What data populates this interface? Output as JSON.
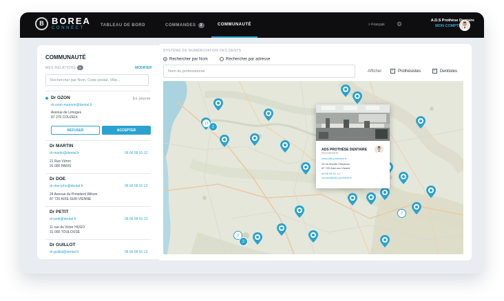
{
  "app": {
    "logo_mark": "B",
    "logo_name": "BOREA",
    "logo_sub": "CONNECT"
  },
  "nav": {
    "tab_dashboard": "TABLEAU DE BORD",
    "tab_orders": "COMMANDES",
    "orders_count": "3",
    "tab_community": "COMMUNAUTÉ",
    "language": "> Français",
    "account_name": "A.D.S Prothèse Dentaire",
    "account_link": "MON COMPTE"
  },
  "left": {
    "title": "COMMUNAUTÉ",
    "relations_label": "MES RELATIONS",
    "relations_count": "5",
    "edit_link": "MODIFIER",
    "search_placeholder": "Rechercher par Nom, Code postal, Ville...",
    "pending": {
      "name": "Dr OZON",
      "email": "dr-ozon-marjorie@dental.fr",
      "status": "En attente",
      "address1": "Avenue de Limoges",
      "address2": "87 270 COUZEIX",
      "decline": "REFUSER",
      "accept": "ACCEPTER"
    },
    "contacts": [
      {
        "name": "Dr MARTIN",
        "email": "dr-martin@dental.fr",
        "phone": "06 66 58 91 12",
        "address1": "21 Rue Véron",
        "address2": "91 000 PARIS"
      },
      {
        "name": "Dr DOE",
        "email": "dr-doe-john@dental.fr",
        "phone": "06 66 58 91 12",
        "address1": "24 Avenue du Président Wilson",
        "address2": "87 720 AIXE-SUR-VIENNE"
      },
      {
        "name": "Dr PETIT",
        "email": "dr-petit@dental.fr",
        "phone": "06 66 58 91 12",
        "address1": "11 rue du Victor HUGO",
        "address2": "31 000 TOULOUSE"
      },
      {
        "name": "Dr GUILLOT",
        "email": "dr-guillot@dental.fr",
        "phone": "06 66 58 91 12",
        "address1": "",
        "address2": ""
      }
    ]
  },
  "right": {
    "section_label": "SYSTÈME DE NUMÉROTATION DES DENTS",
    "radio_name": "Rechercher par Nom",
    "radio_address": "Rechercher par adresse",
    "name_placeholder": "Nom du professionnel",
    "show_label": "Afficher",
    "filter_prosthetists": "Prothésistes",
    "filter_dentists": "Dentistes"
  },
  "popup": {
    "name": "ADS PROTHÈSE DENTAIRE",
    "role": "PROTHÉSISTE",
    "website": "www.ads-prothese.fr",
    "address1": "24 du Moulin Cheyroux",
    "address2": "87 720 Aixe-sur-Vienne",
    "phone": "06 66 58 91 12",
    "email": "contact@ads-prothese.fr"
  },
  "map": {
    "cluster_labels": [
      "12",
      "2",
      "2",
      "3",
      "2"
    ]
  },
  "colors": {
    "accent": "#2aa3cf",
    "topbar": "#0e0e10",
    "map_land": "#e6e8dc",
    "marker": "#2aa3cf"
  }
}
